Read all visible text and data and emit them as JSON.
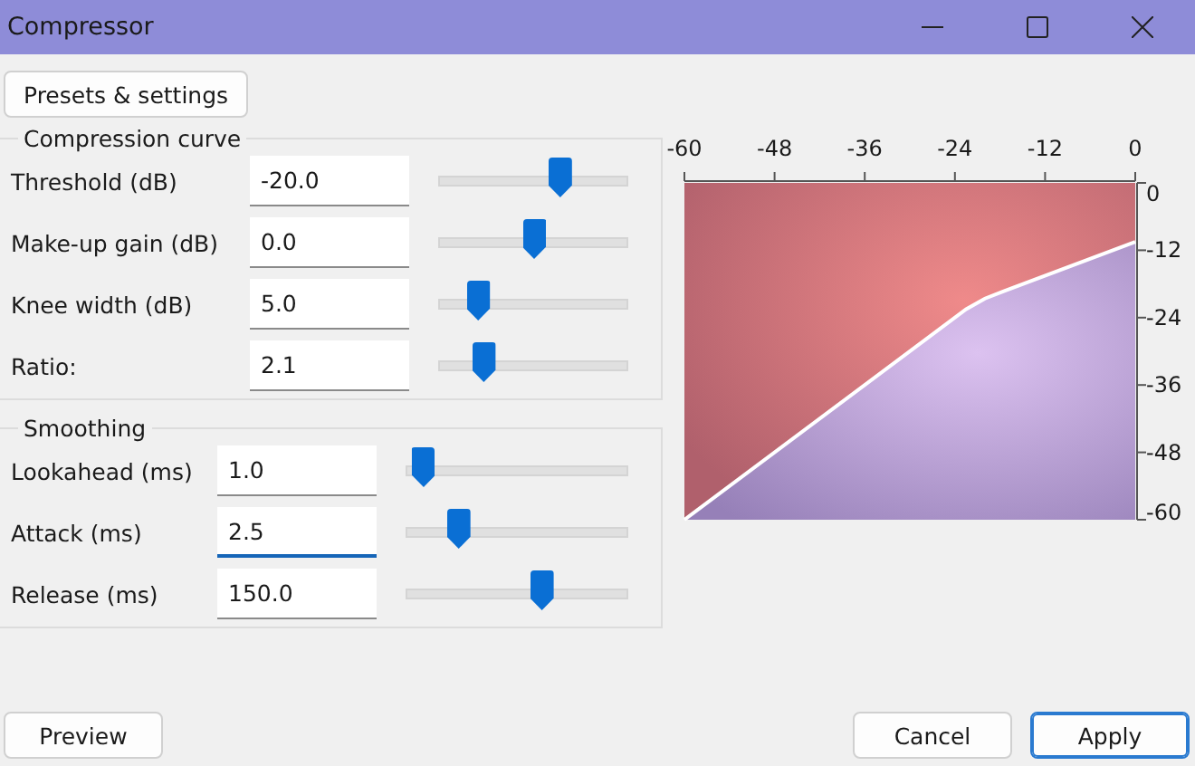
{
  "window": {
    "title": "Compressor"
  },
  "presets_button": "Presets & settings",
  "groups": [
    {
      "title": "Compression curve",
      "fields": [
        {
          "label": "Threshold (dB)",
          "value": "-20.0",
          "level": 0.64,
          "focused": false
        },
        {
          "label": "Make-up gain (dB)",
          "value": "0.0",
          "level": 0.5,
          "focused": false
        },
        {
          "label": "Knee width (dB)",
          "value": "5.0",
          "level": 0.2,
          "focused": false
        },
        {
          "label": "Ratio:",
          "value": "2.1",
          "level": 0.23,
          "focused": false
        }
      ]
    },
    {
      "title": "Smoothing",
      "fields": [
        {
          "label": "Lookahead (ms)",
          "value": "1.0",
          "level": 0.07,
          "focused": false
        },
        {
          "label": "Attack (ms)",
          "value": "2.5",
          "level": 0.23,
          "focused": true
        },
        {
          "label": "Release (ms)",
          "value": "150.0",
          "level": 0.61,
          "focused": false
        }
      ]
    }
  ],
  "chart_data": {
    "type": "line",
    "x": [
      -60,
      -22.5,
      -20,
      -17.5,
      0
    ],
    "values": [
      -60,
      -22.5,
      -20.6,
      -19.3,
      -10.5
    ],
    "xlim": [
      -60,
      0
    ],
    "ylim": [
      -60,
      0
    ],
    "xticks": [
      -60,
      -48,
      -36,
      -24,
      -12,
      0
    ],
    "yticks": [
      0,
      -12,
      -24,
      -36,
      -48,
      -60
    ]
  },
  "buttons": [
    {
      "label": "Preview",
      "default": false
    },
    {
      "label": "Cancel",
      "default": false
    },
    {
      "label": "Apply",
      "default": true
    }
  ]
}
